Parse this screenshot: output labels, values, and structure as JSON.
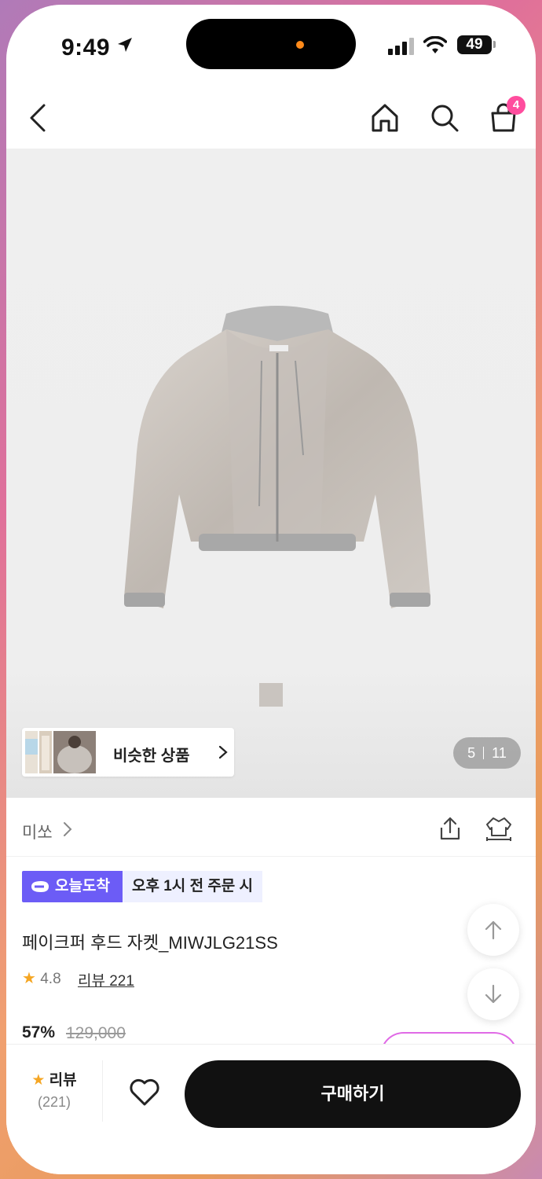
{
  "status": {
    "time": "9:49",
    "battery": "49"
  },
  "nav": {
    "cart_count": "4"
  },
  "gallery": {
    "similar_label": "비슷한 상품",
    "page_current": "5",
    "page_total": "11"
  },
  "product": {
    "brand": "미쏘",
    "delivery_badge": "오늘도착",
    "delivery_condition": "오후 1시 전 주문 시",
    "title": "페이크퍼 후드 자켓_MIWJLG21SS",
    "rating": "4.8",
    "review_link": "리뷰 221",
    "discount": "57%",
    "original_price": "129,000"
  },
  "bottom": {
    "review_label": "리뷰",
    "review_count": "(221)",
    "buy_label": "구매하기"
  },
  "colors": {
    "delivery_purple": "#6c5cf6",
    "badge_pink": "#ff4d9e",
    "star": "#f5a623"
  }
}
